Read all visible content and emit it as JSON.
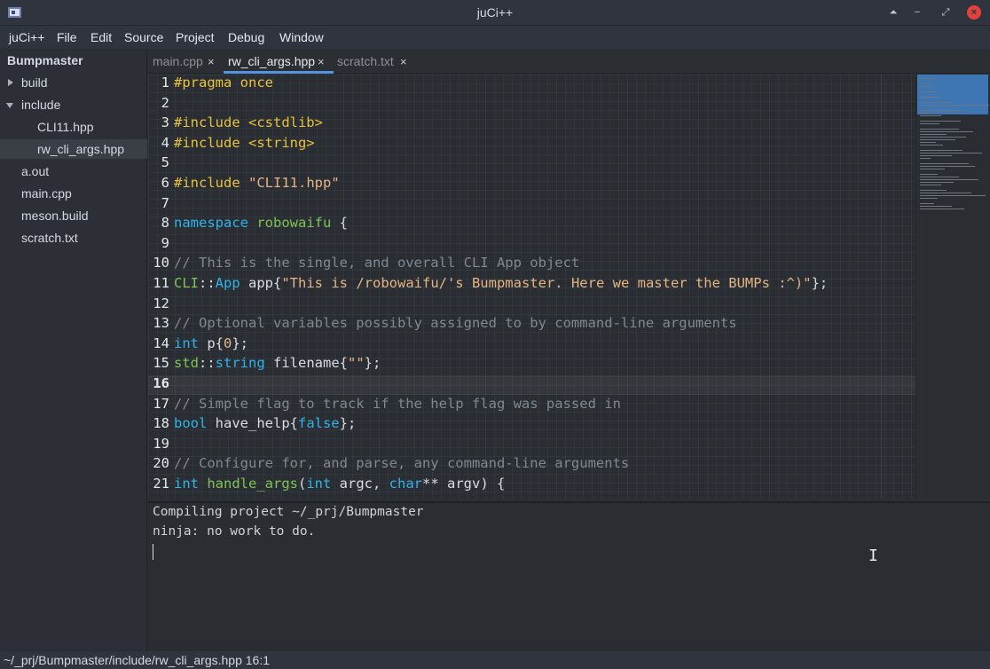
{
  "window": {
    "title": "juCi++"
  },
  "menu": [
    "juCi++",
    "File",
    "Edit",
    "Source",
    "Project",
    "Debug",
    "Window"
  ],
  "sidebar": {
    "project": "Bumpmaster",
    "items": [
      {
        "label": "build",
        "state": "collapsed"
      },
      {
        "label": "include",
        "state": "expanded"
      },
      {
        "label": "CLI11.hpp"
      },
      {
        "label": "rw_cli_args.hpp",
        "selected": true
      },
      {
        "label": "a.out"
      },
      {
        "label": "main.cpp"
      },
      {
        "label": "meson.build"
      },
      {
        "label": "scratch.txt"
      }
    ]
  },
  "tabs": [
    {
      "label": "main.cpp",
      "close": "×"
    },
    {
      "label": "rw_cli_args.hpp",
      "close": "×",
      "active": true
    },
    {
      "label": "scratch.txt",
      "close": "×"
    }
  ],
  "editor": {
    "current_line": 16,
    "lines": [
      {
        "n": "1",
        "t": [
          [
            "pp",
            "#pragma once"
          ]
        ]
      },
      {
        "n": "2",
        "t": []
      },
      {
        "n": "3",
        "t": [
          [
            "pp",
            "#include <cstdlib>"
          ]
        ]
      },
      {
        "n": "4",
        "t": [
          [
            "pp",
            "#include <string>"
          ]
        ]
      },
      {
        "n": "5",
        "t": []
      },
      {
        "n": "6",
        "t": [
          [
            "pp",
            "#include "
          ],
          [
            "str",
            "\"CLI11.hpp\""
          ]
        ]
      },
      {
        "n": "7",
        "t": []
      },
      {
        "n": "8",
        "t": [
          [
            "kw",
            "namespace "
          ],
          [
            "ty",
            "robowaifu"
          ],
          [
            "tx",
            " {"
          ]
        ]
      },
      {
        "n": "9",
        "t": []
      },
      {
        "n": "10",
        "t": [
          [
            "cm",
            "// This is the single, and overall CLI App object"
          ]
        ]
      },
      {
        "n": "11",
        "t": [
          [
            "ty",
            "CLI"
          ],
          [
            "tx",
            "::"
          ],
          [
            "kw",
            "App"
          ],
          [
            "tx",
            " app{"
          ],
          [
            "str",
            "\"This is /robowaifu/'s Bumpmaster. Here we master the BUMPs :^)\""
          ],
          [
            "tx",
            "};"
          ]
        ]
      },
      {
        "n": "12",
        "t": []
      },
      {
        "n": "13",
        "t": [
          [
            "cm",
            "// Optional variables possibly assigned to by command-line arguments"
          ]
        ]
      },
      {
        "n": "14",
        "t": [
          [
            "kw",
            "int"
          ],
          [
            "tx",
            " p{"
          ],
          [
            "num",
            "0"
          ],
          [
            "tx",
            "};"
          ]
        ]
      },
      {
        "n": "15",
        "t": [
          [
            "ty",
            "std"
          ],
          [
            "tx",
            "::"
          ],
          [
            "kw",
            "string"
          ],
          [
            "tx",
            " filename{"
          ],
          [
            "str",
            "\"\""
          ],
          [
            "tx",
            "};"
          ]
        ]
      },
      {
        "n": "16",
        "t": []
      },
      {
        "n": "17",
        "t": [
          [
            "cm",
            "// Simple flag to track if the help flag was passed in"
          ]
        ]
      },
      {
        "n": "18",
        "t": [
          [
            "kw",
            "bool"
          ],
          [
            "tx",
            " have_help{"
          ],
          [
            "kw",
            "false"
          ],
          [
            "tx",
            "};"
          ]
        ]
      },
      {
        "n": "19",
        "t": []
      },
      {
        "n": "20",
        "t": [
          [
            "cm",
            "// Configure for, and parse, any command-line arguments"
          ]
        ]
      },
      {
        "n": "21",
        "t": [
          [
            "kw",
            "int"
          ],
          [
            "tx",
            " "
          ],
          [
            "ty",
            "handle_args"
          ],
          [
            "tx",
            "("
          ],
          [
            "kw",
            "int"
          ],
          [
            "tx",
            " argc, "
          ],
          [
            "kw",
            "char"
          ],
          [
            "tx",
            "** argv) {"
          ]
        ]
      }
    ]
  },
  "terminal": {
    "lines": [
      "Compiling project ~/_prj/Bumpmaster",
      "ninja: no work to do."
    ]
  },
  "status": {
    "text": "~/_prj/Bumpmaster/include/rw_cli_args.hpp 16:1"
  },
  "colors": {
    "accent": "#5294e2",
    "close": "#e0423c",
    "keyword": "#2fb3e8",
    "preprocessor": "#e8c23b",
    "string": "#e5b483",
    "comment": "#7f8891",
    "type": "#7fc356"
  }
}
